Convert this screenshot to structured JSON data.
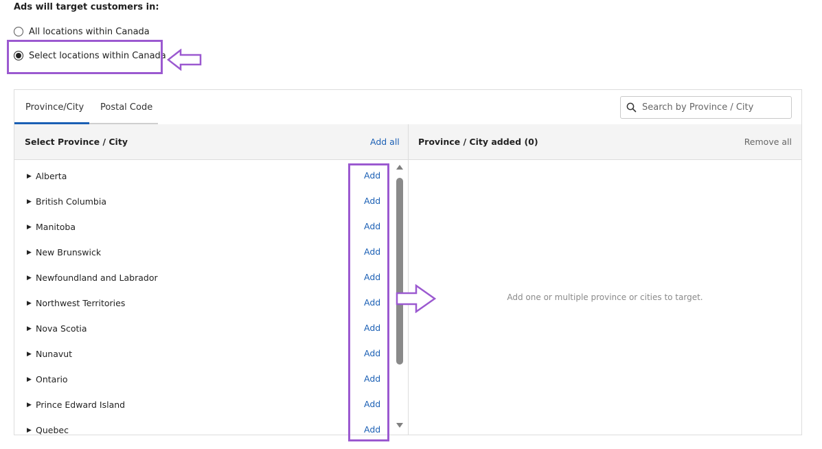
{
  "heading": "Ads will target customers in:",
  "radio_options": [
    {
      "label": "All locations within Canada",
      "selected": false
    },
    {
      "label": "Select locations within Canada",
      "selected": true
    }
  ],
  "tabs": [
    {
      "label": "Province/City",
      "active": true
    },
    {
      "label": "Postal Code",
      "active": false
    }
  ],
  "search": {
    "placeholder": "Search by Province / City",
    "value": ""
  },
  "left_column": {
    "title": "Select Province / City",
    "add_all_label": "Add all",
    "add_label": "Add",
    "items": [
      "Alberta",
      "British Columbia",
      "Manitoba",
      "New Brunswick",
      "Newfoundland and Labrador",
      "Northwest Territories",
      "Nova Scotia",
      "Nunavut",
      "Ontario",
      "Prince Edward Island",
      "Quebec"
    ]
  },
  "right_column": {
    "title": "Province / City added (0)",
    "remove_all_label": "Remove all",
    "empty_message": "Add one or multiple province or cities to target."
  },
  "colors": {
    "accent": "#1a5fb4",
    "highlight": "#9b59d0"
  },
  "icons": {
    "search": "search-icon",
    "caret": "caret-right-icon",
    "annotation_left": "arrow-left-icon",
    "annotation_right": "arrow-right-icon"
  }
}
